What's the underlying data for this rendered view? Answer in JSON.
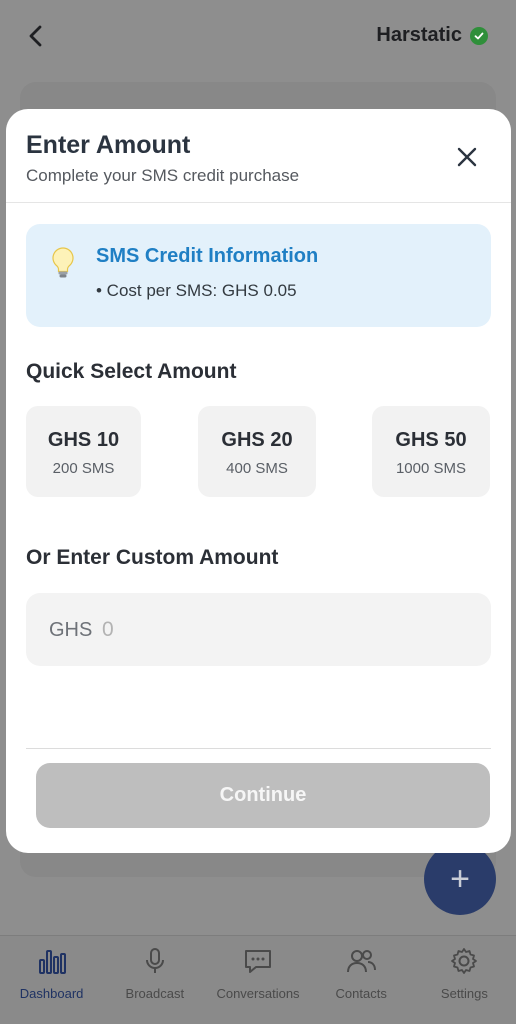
{
  "header": {
    "account_name": "Harstatic"
  },
  "modal": {
    "title": "Enter Amount",
    "subtitle": "Complete your SMS credit purchase",
    "info": {
      "heading": "SMS Credit Information",
      "line": "• Cost per SMS: GHS 0.05"
    },
    "quick_select_title": "Quick Select Amount",
    "amounts": [
      {
        "amount": "GHS 10",
        "sms": "200 SMS"
      },
      {
        "amount": "GHS 20",
        "sms": "400 SMS"
      },
      {
        "amount": "GHS 50",
        "sms": "1000 SMS"
      }
    ],
    "custom_title": "Or Enter Custom Amount",
    "custom_currency": "GHS",
    "custom_placeholder": "0",
    "continue_label": "Continue"
  },
  "tabs": [
    {
      "label": "Dashboard",
      "icon": "bar-chart-icon",
      "active": true
    },
    {
      "label": "Broadcast",
      "icon": "microphone-icon",
      "active": false
    },
    {
      "label": "Conversations",
      "icon": "chat-bubble-icon",
      "active": false
    },
    {
      "label": "Contacts",
      "icon": "people-icon",
      "active": false
    },
    {
      "label": "Settings",
      "icon": "gear-icon",
      "active": false
    }
  ],
  "colors": {
    "accent_blue": "#1f7fc4",
    "fab": "#2a3c6a",
    "verified_green": "#2f8f3a"
  }
}
